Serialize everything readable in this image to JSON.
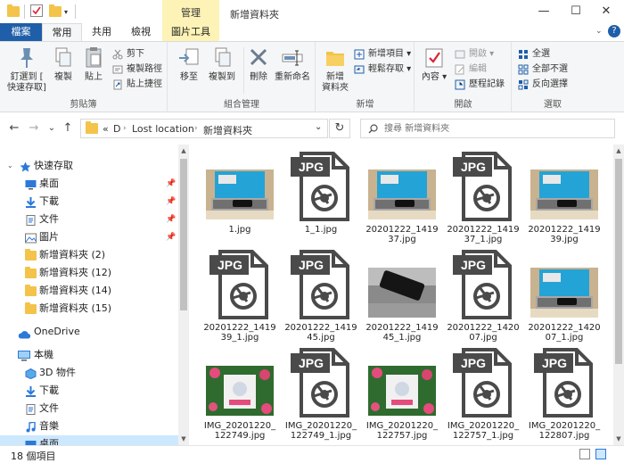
{
  "titlebar": {
    "context_tab": "管理",
    "window_title": "新增資料夾",
    "minimize": "—",
    "maximize": "☐",
    "close": "✕"
  },
  "tabs": {
    "file": "檔案",
    "home": "常用",
    "share": "共用",
    "view": "檢視",
    "picture_tools": "圖片工具"
  },
  "ribbon": {
    "clipboard": {
      "label": "剪貼簿",
      "pin_quick": "釘選到 [",
      "pin_quick2": "快速存取]",
      "copy": "複製",
      "paste": "貼上",
      "cut": "剪下",
      "copy_path": "複製路徑",
      "paste_shortcut": "貼上捷徑"
    },
    "organize": {
      "label": "組合管理",
      "move_to": "移至",
      "copy_to": "複製到",
      "delete": "刪除",
      "rename": "重新命名"
    },
    "new": {
      "label": "新增",
      "new_folder": "新增",
      "new_folder2": "資料夾",
      "new_item": "新增項目",
      "easy_access": "輕鬆存取"
    },
    "open": {
      "label": "開啟",
      "properties": "內容",
      "open": "開啟",
      "edit": "編輯",
      "history": "歷程記錄"
    },
    "select": {
      "label": "選取",
      "select_all": "全選",
      "select_none": "全部不選",
      "invert": "反向選擇"
    }
  },
  "address": {
    "back": "←",
    "forward": "→",
    "recent": "⌄",
    "up": "↑",
    "chevrons": "«",
    "crumbs": [
      "D",
      "Lost location",
      "新增資料夾"
    ],
    "dropdown": "⌄",
    "refresh": "↻",
    "search_placeholder": "搜尋 新增資料夾"
  },
  "navpane": {
    "quick_access": "快速存取",
    "quick_items": [
      {
        "label": "桌面",
        "icon": "desktop-icon"
      },
      {
        "label": "下載",
        "icon": "download-icon"
      },
      {
        "label": "文件",
        "icon": "document-icon"
      },
      {
        "label": "圖片",
        "icon": "pictures-icon"
      }
    ],
    "folders": [
      "新增資料夾 (2)",
      "新增資料夾 (12)",
      "新增資料夾 (14)",
      "新增資料夾 (15)"
    ],
    "onedrive": "OneDrive",
    "this_pc": "本機",
    "pc_items": [
      {
        "label": "3D 物件",
        "icon": "3d-objects-icon"
      },
      {
        "label": "下載",
        "icon": "download-icon"
      },
      {
        "label": "文件",
        "icon": "document-icon"
      },
      {
        "label": "音樂",
        "icon": "music-icon"
      },
      {
        "label": "桌面",
        "icon": "desktop-icon"
      }
    ]
  },
  "files": [
    {
      "name": "1.jpg",
      "type": "photo-laptop"
    },
    {
      "name": "1_1.jpg",
      "type": "jpg-icon"
    },
    {
      "name": "20201222_141937.jpg",
      "type": "photo-laptop"
    },
    {
      "name": "20201222_141937_1.jpg",
      "type": "jpg-icon"
    },
    {
      "name": "20201222_141939.jpg",
      "type": "photo-laptop"
    },
    {
      "name": "20201222_141939_1.jpg",
      "type": "jpg-icon"
    },
    {
      "name": "20201222_141945.jpg",
      "type": "jpg-icon"
    },
    {
      "name": "20201222_141945_1.jpg",
      "type": "photo-phone"
    },
    {
      "name": "20201222_142007.jpg",
      "type": "jpg-icon"
    },
    {
      "name": "20201222_142007_1.jpg",
      "type": "photo-laptop"
    },
    {
      "name": "IMG_20201220_122749.jpg",
      "type": "photo-flowers"
    },
    {
      "name": "IMG_20201220_122749_1.jpg",
      "type": "jpg-icon"
    },
    {
      "name": "IMG_20201220_122757.jpg",
      "type": "photo-flowers"
    },
    {
      "name": "IMG_20201220_122757_1.jpg",
      "type": "jpg-icon"
    },
    {
      "name": "IMG_20201220_122807.jpg",
      "type": "jpg-icon"
    }
  ],
  "file_display": [
    [
      "1.jpg"
    ],
    [
      "1_1.jpg"
    ],
    [
      "20201222_1419",
      "37.jpg"
    ],
    [
      "20201222_1419",
      "37_1.jpg"
    ],
    [
      "20201222_1419",
      "39.jpg"
    ],
    [
      "20201222_1419",
      "39_1.jpg"
    ],
    [
      "20201222_1419",
      "45.jpg"
    ],
    [
      "20201222_1419",
      "45_1.jpg"
    ],
    [
      "20201222_1420",
      "07.jpg"
    ],
    [
      "20201222_1420",
      "07_1.jpg"
    ],
    [
      "IMG_20201220_",
      "122749.jpg"
    ],
    [
      "IMG_20201220_",
      "122749_1.jpg"
    ],
    [
      "IMG_20201220_",
      "122757.jpg"
    ],
    [
      "IMG_20201220_",
      "122757_1.jpg"
    ],
    [
      "IMG_20201220_",
      "122807.jpg"
    ]
  ],
  "jpg_badge": "JPG",
  "status": {
    "count": "18 個項目"
  },
  "colors": {
    "accent": "#1f5ea8",
    "context_tab": "#fdf3b6",
    "folder": "#f3c34a",
    "jpg_icon": "#4a4a4a",
    "selected": "#cce8ff"
  }
}
